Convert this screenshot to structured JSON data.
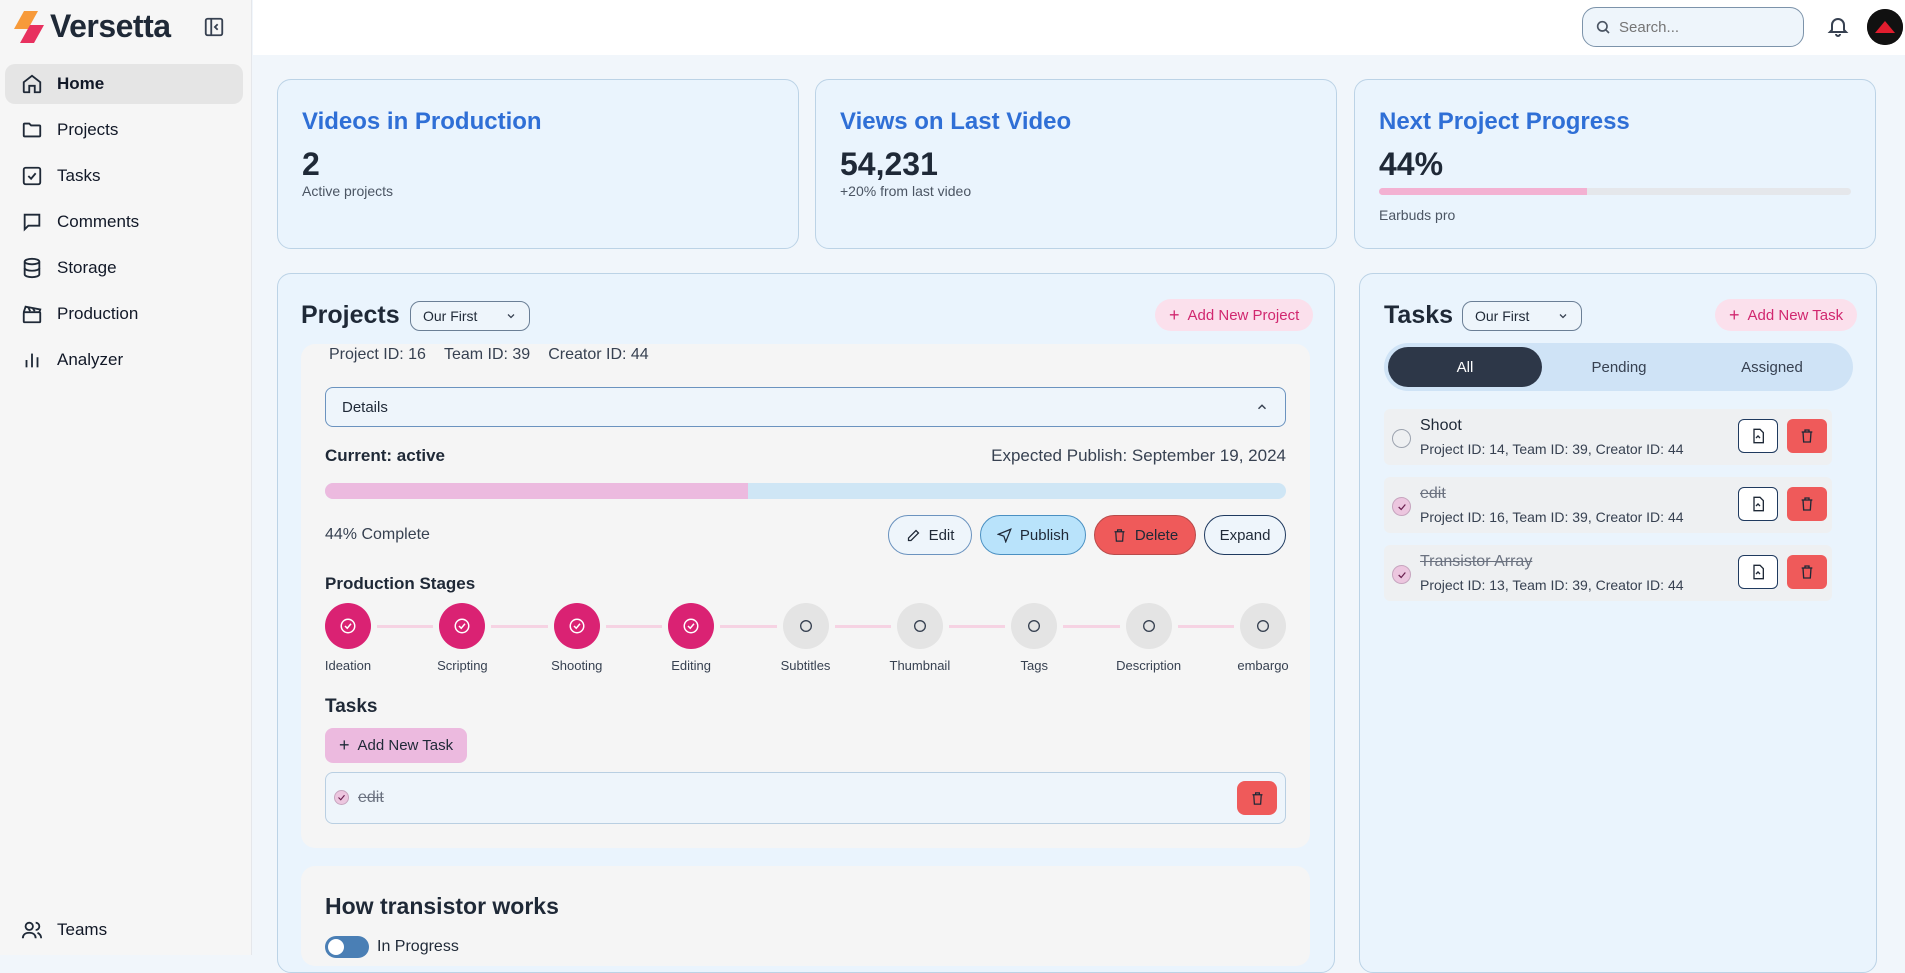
{
  "app": {
    "name": "Versetta"
  },
  "sidebar": {
    "items": [
      {
        "label": "Home",
        "icon": "home-icon"
      },
      {
        "label": "Projects",
        "icon": "folder-icon"
      },
      {
        "label": "Tasks",
        "icon": "checkbox-icon"
      },
      {
        "label": "Comments",
        "icon": "message-icon"
      },
      {
        "label": "Storage",
        "icon": "database-icon"
      },
      {
        "label": "Production",
        "icon": "clapperboard-icon"
      },
      {
        "label": "Analyzer",
        "icon": "bar-chart-icon"
      }
    ],
    "bottom": {
      "label": "Teams",
      "icon": "users-icon"
    }
  },
  "header": {
    "search_placeholder": "Search..."
  },
  "stats": [
    {
      "title": "Videos in Production",
      "value": "2",
      "sub": "Active projects"
    },
    {
      "title": "Views on Last Video",
      "value": "54,231",
      "sub": "+20% from last video"
    },
    {
      "title": "Next Project Progress",
      "value": "44%",
      "sub": "Earbuds pro",
      "progress": 0.44
    }
  ],
  "projects": {
    "title": "Projects",
    "filter": "Our First",
    "add_label": "Add New Project",
    "meta": {
      "project_id": "Project ID: 16",
      "team_id": "Team ID: 39",
      "creator_id": "Creator ID: 44"
    },
    "details_label": "Details",
    "current_label": "Current:",
    "current_value": "active",
    "expected": "Expected Publish: September 19, 2024",
    "progress": 0.44,
    "complete_label": "44% Complete",
    "buttons": {
      "edit": "Edit",
      "publish": "Publish",
      "delete": "Delete",
      "expand": "Expand"
    },
    "stages_title": "Production Stages",
    "stages": [
      {
        "label": "Ideation",
        "done": true
      },
      {
        "label": "Scripting",
        "done": true
      },
      {
        "label": "Shooting",
        "done": true
      },
      {
        "label": "Editing",
        "done": true
      },
      {
        "label": "Subtitles",
        "done": false
      },
      {
        "label": "Thumbnail",
        "done": false
      },
      {
        "label": "Tags",
        "done": false
      },
      {
        "label": "Description",
        "done": false
      },
      {
        "label": "embargo",
        "done": false
      }
    ],
    "tasks_title": "Tasks",
    "add_task_label": "Add New Task",
    "task": {
      "name": "edit",
      "done": true
    },
    "next_title": "How transistor works",
    "next_status": "In Progress"
  },
  "tasks": {
    "title": "Tasks",
    "filter": "Our First",
    "add_label": "Add New Task",
    "tabs": [
      "All",
      "Pending",
      "Assigned"
    ],
    "items": [
      {
        "name": "Shoot",
        "meta": "Project ID: 14, Team ID: 39, Creator ID: 44",
        "done": false
      },
      {
        "name": "edit",
        "meta": "Project ID: 16, Team ID: 39, Creator ID: 44",
        "done": true
      },
      {
        "name": "Transistor Array",
        "meta": "Project ID: 13, Team ID: 39, Creator ID: 44",
        "done": true
      }
    ]
  },
  "colors": {
    "accent": "#2f6fd6",
    "pink": "#da2273",
    "danger": "#ef5a5a"
  }
}
